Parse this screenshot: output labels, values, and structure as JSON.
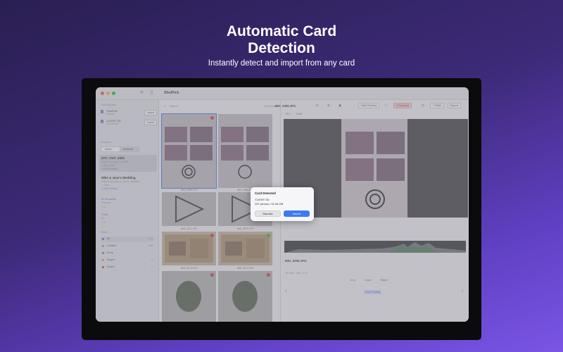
{
  "hero": {
    "title_line1": "Automatic Card",
    "title_line2": "Detection",
    "subtitle": "Instantly detect and import from any card"
  },
  "app": {
    "title": "ShotPick",
    "colors": {
      "accent": "#3c7bf0",
      "close": "#ff5f57",
      "minimize": "#febc2e",
      "zoom": "#28c840"
    }
  },
  "sidebar": {
    "sources_label": "Card Sources",
    "sources": [
      {
        "name": "ShotPick",
        "sub": "Culinda",
        "button": "Import"
      },
      {
        "name": "CLIENT SD",
        "sub": "257 photos",
        "button": "Import"
      }
    ],
    "sessions_label": "Sessions",
    "segments": [
      "Active",
      "Archived"
    ],
    "sessions": [
      {
        "title": "DAY_OUT_2026",
        "path": "2026-02-14_day_out_2026",
        "meta": "▭ 14   ◎ 6   ■ 4",
        "status": "1 RAW Pending"
      },
      {
        "title": "Mike & Jane's Wedding",
        "path": "2026-02-18_Mike_&_Jane's_Wedding",
        "meta": "▭ 2   ■ 2",
        "status": "1 RAW Pending"
      }
    ],
    "tags": [
      {
        "label": "★ Personal",
        "sub": "Personal",
        "meta": "▭ 3",
        "color": "#3c7bf0"
      },
      {
        "label": "✎ Art",
        "sub": "Art",
        "meta": "▭ 3",
        "color": "#d04a8a"
      }
    ],
    "filters_label": "Filters",
    "filters": [
      {
        "label": "All",
        "count": "123",
        "color": "#3c7bf0"
      },
      {
        "label": "Unrated",
        "count": "108",
        "color": "#999999"
      },
      {
        "label": "Keep",
        "count": "7",
        "color": "#3bb35a"
      },
      {
        "label": "Maybe",
        "count": "4",
        "color": "#f0a030"
      },
      {
        "label": "Reject",
        "count": "4",
        "color": "#e04545"
      }
    ]
  },
  "grid": {
    "search_placeholder": "Search",
    "count": "123 photos",
    "items": [
      {
        "name": "IMG_9369.JPG",
        "badge": "#e04545"
      },
      {
        "name": "IMG_9369.JPG",
        "badge": ""
      },
      {
        "name": "IMG_9371.JPG",
        "badge": ""
      },
      {
        "name": "IMG_9370.JPG",
        "badge": "#3bb35a"
      },
      {
        "name": "IMG_9372.JPG",
        "badge": "#e04545"
      },
      {
        "name": "IMG_9372.JPG",
        "badge": "#3bb35a"
      },
      {
        "name": "IMG_9373.JPG",
        "badge": "#e04545"
      },
      {
        "name": "IMG_9374.JPG",
        "badge": "#e04545"
      }
    ]
  },
  "preview": {
    "filename": "IMG_9369.JPG",
    "hide_preview": "Hide Preview",
    "rejected": "4 Rejected",
    "raw": "7 RAW",
    "export": "Export",
    "tabs": [
      "JPG",
      "RAW"
    ],
    "info_name": "IMG_9369.JPG",
    "info_meta": "ISO 200 · 1/50 · f/2.8",
    "decisions": [
      "Keep",
      "Maybe",
      "Reject"
    ],
    "raw_status": "RAW Pending"
  },
  "dialog": {
    "title": "Card Detected",
    "card_name": "CLIENT SD",
    "summary": "257 photos • 31.66 GB",
    "dismiss": "Dismiss",
    "import": "Import"
  }
}
